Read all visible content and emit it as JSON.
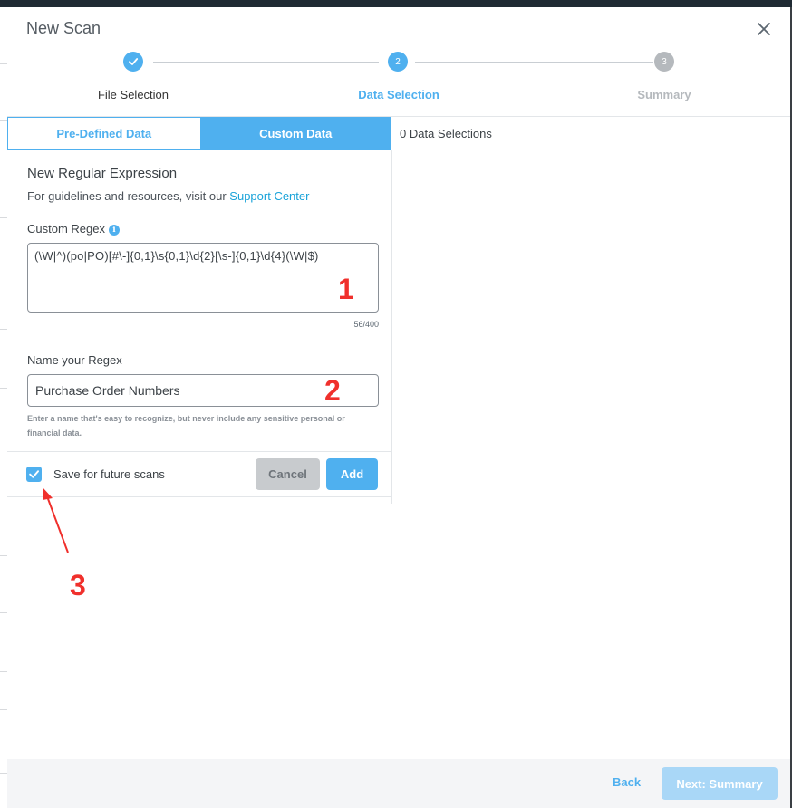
{
  "modal": {
    "title": "New Scan"
  },
  "stepper": {
    "steps": [
      {
        "number": "",
        "label": "File Selection",
        "state": "done"
      },
      {
        "number": "2",
        "label": "Data Selection",
        "state": "active"
      },
      {
        "number": "3",
        "label": "Summary",
        "state": "pending"
      }
    ]
  },
  "tabs": {
    "predefined": "Pre-Defined Data",
    "custom": "Custom Data"
  },
  "selections": {
    "count_text": "0 Data Selections"
  },
  "form": {
    "section_title": "New Regular Expression",
    "guidelines_text": "For guidelines and resources, visit our",
    "support_link": "Support Center",
    "regex_label": "Custom Regex",
    "info_glyph": "i",
    "regex_value": "(\\W|^)(po|PO)[#\\-]{0,1}\\s{0,1}\\d{2}[\\s-]{0,1}\\d{4}(\\W|$)",
    "char_count": "56/400",
    "name_label": "Name your Regex",
    "name_value": "Purchase Order Numbers",
    "name_hint": "Enter a name that's easy to recognize, but never include any sensitive personal or financial data.",
    "save_label": "Save for future scans",
    "save_checked": true,
    "cancel_label": "Cancel",
    "add_label": "Add"
  },
  "annotations": [
    "1",
    "2",
    "3"
  ],
  "footer": {
    "back_label": "Back",
    "next_label": "Next: Summary"
  },
  "colors": {
    "accent": "#4fb0ef",
    "annotation": "#f0302c",
    "link": "#1aa3d9"
  },
  "icons": {
    "close": "close-icon",
    "check": "check-icon",
    "info": "info-icon"
  }
}
